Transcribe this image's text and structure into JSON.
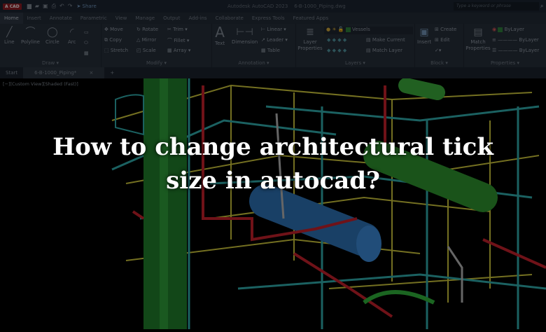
{
  "titlebar": {
    "logo": "A CAD",
    "share": "Share",
    "app_title": "Autodesk AutoCAD 2023",
    "file_title": "6-B-1000_Piping.dwg",
    "search_placeholder": "Type a keyword or phrase"
  },
  "ribbon_tabs": [
    "Home",
    "Insert",
    "Annotate",
    "Parametric",
    "View",
    "Manage",
    "Output",
    "Add-ins",
    "Collaborate",
    "Express Tools",
    "Featured Apps"
  ],
  "draw": {
    "label": "Draw ▾",
    "line": "Line",
    "polyline": "Polyline",
    "circle": "Circle",
    "arc": "Arc"
  },
  "modify": {
    "label": "Modify ▾",
    "move": "Move",
    "rotate": "Rotate",
    "trim": "Trim ▾",
    "copy": "Copy",
    "mirror": "Mirror",
    "fillet": "Fillet ▾",
    "stretch": "Stretch",
    "scale": "Scale",
    "array": "Array ▾"
  },
  "annotation": {
    "label": "Annotation ▾",
    "text": "Text",
    "dimension": "Dimension",
    "linear": "Linear ▾",
    "leader": "Leader ▾",
    "table": "Table"
  },
  "layers": {
    "label": "Layers ▾",
    "layer_properties": "Layer Properties",
    "current_layer": "Vessels",
    "make_current": "Make Current",
    "match_layer": "Match Layer"
  },
  "block": {
    "label": "Block ▾",
    "insert": "Insert",
    "create": "Create",
    "edit": "Edit"
  },
  "properties": {
    "label": "Properties ▾",
    "match_properties": "Match Properties",
    "color": "ByLayer",
    "linetype": "ByLayer",
    "lineweight": "ByLayer"
  },
  "doc_tabs": {
    "start": "Start",
    "current": "6-B-1000_Piping*",
    "close": "×",
    "new": "+"
  },
  "viewport": {
    "label": "[−][Custom View][Shaded (Fast)]"
  },
  "headline": {
    "line1": "How to change architectural tick",
    "line2": "size in autocad?"
  }
}
